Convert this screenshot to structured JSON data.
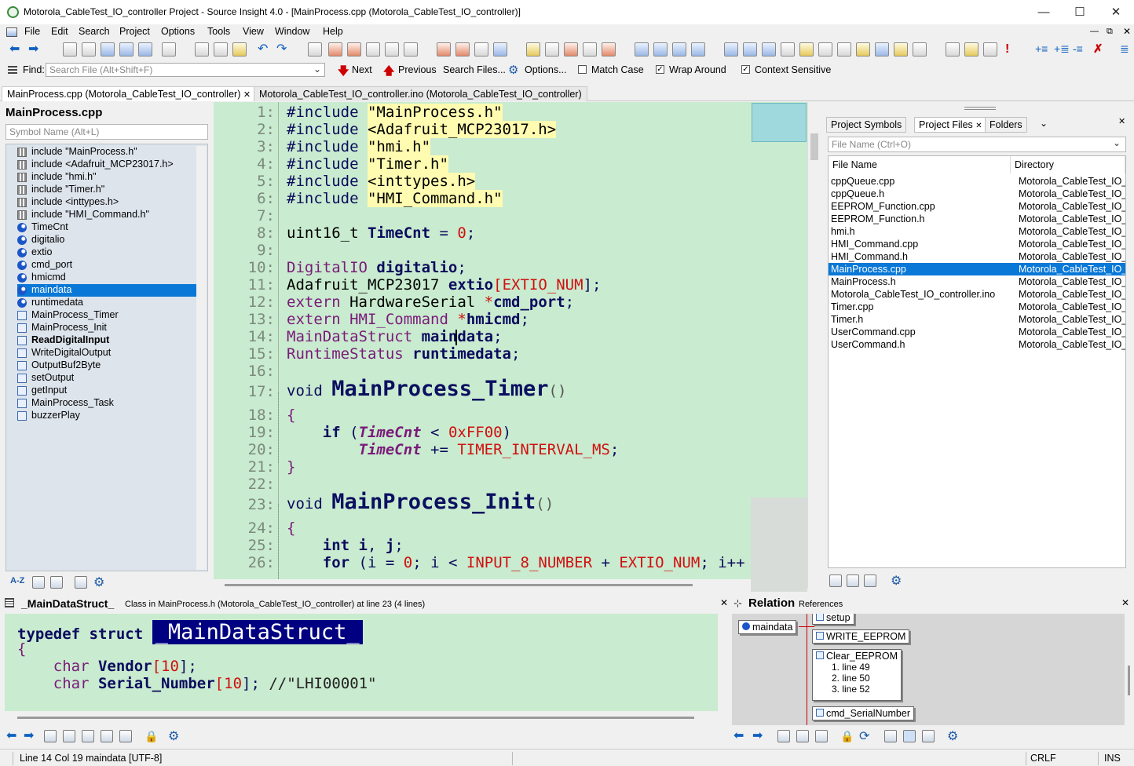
{
  "window": {
    "title": "Motorola_CableTest_IO_controller Project - Source Insight 4.0 - [MainProcess.cpp (Motorola_CableTest_IO_controller)]",
    "minimize": "—",
    "maximize": "☐",
    "close": "✕"
  },
  "menu": [
    "File",
    "Edit",
    "Search",
    "Project",
    "Options",
    "Tools",
    "View",
    "Window",
    "Help"
  ],
  "find": {
    "label": "Find:",
    "placeholder": "Search File (Alt+Shift+F)",
    "next": "Next",
    "previous": "Previous",
    "search_files": "Search Files...",
    "options": "Options...",
    "match_case": "Match Case",
    "wrap_around": "Wrap Around",
    "context_sensitive": "Context Sensitive",
    "match_case_checked": false,
    "wrap_around_checked": true,
    "context_sensitive_checked": true
  },
  "tabs": [
    {
      "label": "MainProcess.cpp (Motorola_CableTest_IO_controller)",
      "close": "✕"
    },
    {
      "label": "Motorola_CableTest_IO_controller.ino (Motorola_CableTest_IO_controller)"
    }
  ],
  "symbols": {
    "file": "MainProcess.cpp",
    "placeholder": "Symbol Name (Alt+L)",
    "items": [
      {
        "label": "include \"MainProcess.h\"",
        "kind": "include"
      },
      {
        "label": "include <Adafruit_MCP23017.h>",
        "kind": "include"
      },
      {
        "label": "include \"hmi.h\"",
        "kind": "include"
      },
      {
        "label": "include \"Timer.h\"",
        "kind": "include"
      },
      {
        "label": "include <inttypes.h>",
        "kind": "include"
      },
      {
        "label": "include \"HMI_Command.h\"",
        "kind": "include"
      },
      {
        "label": "TimeCnt",
        "kind": "var"
      },
      {
        "label": "digitalio",
        "kind": "var"
      },
      {
        "label": "extio",
        "kind": "var"
      },
      {
        "label": "cmd_port",
        "kind": "var"
      },
      {
        "label": "hmicmd",
        "kind": "var"
      },
      {
        "label": "maindata",
        "kind": "var"
      },
      {
        "label": "runtimedata",
        "kind": "var"
      },
      {
        "label": "MainProcess_Timer",
        "kind": "fn"
      },
      {
        "label": "MainProcess_Init",
        "kind": "fn"
      },
      {
        "label": "ReadDigitalInput",
        "kind": "fn"
      },
      {
        "label": "WriteDigitalOutput",
        "kind": "fn"
      },
      {
        "label": "OutputBuf2Byte",
        "kind": "fn"
      },
      {
        "label": "setOutput",
        "kind": "fn"
      },
      {
        "label": "getInput",
        "kind": "fn"
      },
      {
        "label": "MainProcess_Task",
        "kind": "fn"
      },
      {
        "label": "buzzerPlay",
        "kind": "fn"
      }
    ],
    "selected": "maindata",
    "sort_label": "A-Z"
  },
  "editor": {
    "line_numbers": [
      "1:",
      "2:",
      "3:",
      "4:",
      "5:",
      "6:",
      "7:",
      "8:",
      "9:",
      "10:",
      "11:",
      "12:",
      "13:",
      "14:",
      "15:",
      "16:",
      "17:",
      "18:",
      "19:",
      "20:",
      "21:",
      "22:",
      "23:",
      "24:",
      "25:",
      "26:"
    ],
    "lines": {
      "l1a": "#include ",
      "l1b": "\"MainProcess.h\"",
      "l2a": "#include ",
      "l2b": "<Adafruit_MCP23017.h>",
      "l3a": "#include ",
      "l3b": "\"hmi.h\"",
      "l4a": "#include ",
      "l4b": "\"Timer.h\"",
      "l5a": "#include ",
      "l5b": "<inttypes.h>",
      "l6a": "#include ",
      "l6b": "\"HMI_Command.h\"",
      "l8a": "uint16_t ",
      "l8b": "TimeCnt",
      "l8c": " = ",
      "l8d": "0",
      "l8e": ";",
      "l10a": "DigitalIO ",
      "l10b": "digitalio",
      "l10c": ";",
      "l11a": "Adafruit_MCP23017 ",
      "l11b": "extio",
      "l11c": "[",
      "l11d": "EXTIO_NUM",
      "l11e": "];",
      "l12a": "extern ",
      "l12b": "HardwareSerial ",
      "l12c": "*",
      "l12d": "cmd_port",
      "l12e": ";",
      "l13a": "extern ",
      "l13b": "HMI_Command ",
      "l13c": "*",
      "l13d": "hmicmd",
      "l13e": ";",
      "l14a": "MainDataStruct ",
      "l14b": "maindata",
      "l14c": ";",
      "l15a": "RuntimeStatus ",
      "l15b": "runtimedata",
      "l15c": ";",
      "l17a": "void ",
      "l17b": "MainProcess_Timer",
      "l17c": "()",
      "l18": "{",
      "l19a": "    if ",
      "l19b": "(",
      "l19c": "TimeCnt",
      "l19d": " < ",
      "l19e": "0xFF00",
      "l19f": ")",
      "l20a": "        ",
      "l20b": "TimeCnt",
      "l20c": " += ",
      "l20d": "TIMER_INTERVAL_MS",
      "l20e": ";",
      "l21": "}",
      "l23a": "void ",
      "l23b": "MainProcess_Init",
      "l23c": "()",
      "l24": "{",
      "l25a": "    int ",
      "l25b": "i",
      "l25c": ", ",
      "l25d": "j",
      "l25e": ";",
      "l26a": "    for ",
      "l26b": "(",
      "l26c": "i",
      "l26d": " = ",
      "l26e": "0",
      "l26f": "; ",
      "l26g": "i",
      "l26h": " < ",
      "l26i": "INPUT_8_NUMBER",
      "l26j": " + ",
      "l26k": "EXTIO_NUM",
      "l26l": "; ",
      "l26m": "i++"
    }
  },
  "right_panel": {
    "tabs": [
      "Project Symbols",
      "Project Files",
      "Folders"
    ],
    "active_tab": "Project Files",
    "close": "✕",
    "placeholder": "File Name (Ctrl+O)",
    "col_file": "File Name",
    "col_dir": "Directory",
    "files": [
      {
        "name": "cppQueue.cpp",
        "dir": "Motorola_CableTest_IO_"
      },
      {
        "name": "cppQueue.h",
        "dir": "Motorola_CableTest_IO_"
      },
      {
        "name": "EEPROM_Function.cpp",
        "dir": "Motorola_CableTest_IO_"
      },
      {
        "name": "EEPROM_Function.h",
        "dir": "Motorola_CableTest_IO_"
      },
      {
        "name": "hmi.h",
        "dir": "Motorola_CableTest_IO_"
      },
      {
        "name": "HMI_Command.cpp",
        "dir": "Motorola_CableTest_IO_"
      },
      {
        "name": "HMI_Command.h",
        "dir": "Motorola_CableTest_IO_"
      },
      {
        "name": "MainProcess.cpp",
        "dir": "Motorola_CableTest_IO_"
      },
      {
        "name": "MainProcess.h",
        "dir": "Motorola_CableTest_IO_"
      },
      {
        "name": "Motorola_CableTest_IO_controller.ino",
        "dir": "Motorola_CableTest_IO_"
      },
      {
        "name": "Timer.cpp",
        "dir": "Motorola_CableTest_IO_"
      },
      {
        "name": "Timer.h",
        "dir": "Motorola_CableTest_IO_"
      },
      {
        "name": "UserCommand.cpp",
        "dir": "Motorola_CableTest_IO_"
      },
      {
        "name": "UserCommand.h",
        "dir": "Motorola_CableTest_IO_"
      }
    ],
    "selected": "MainProcess.cpp"
  },
  "context": {
    "symbol": "_MainDataStruct_",
    "info": "Class in MainProcess.h (Motorola_CableTest_IO_controller) at line 23 (4 lines)",
    "close": "✕",
    "c1a": "typedef struct ",
    "c1b": "_MainDataStruct_",
    "c2": "{",
    "c3a": "    char ",
    "c3b": "Vendor",
    "c3c": "[",
    "c3d": "10",
    "c3e": "];",
    "c4a": "    char ",
    "c4b": "Serial_Number",
    "c4c": "[",
    "c4d": "10",
    "c4e": "]; ",
    "c4f": "//\"LHI00001\""
  },
  "relation": {
    "title": "Relation",
    "subtitle": "References",
    "close": "✕",
    "root": "maindata",
    "nodes": [
      "setup",
      "WRITE_EEPROM",
      "Clear_EEPROM",
      "cmd_SerialNumber"
    ],
    "lines": [
      "1. line 49",
      "2. line 50",
      "3. line 52"
    ]
  },
  "status": {
    "position": "Line 14  Col 19  maindata  [UTF-8]",
    "eol": "CRLF",
    "mode": "INS"
  }
}
